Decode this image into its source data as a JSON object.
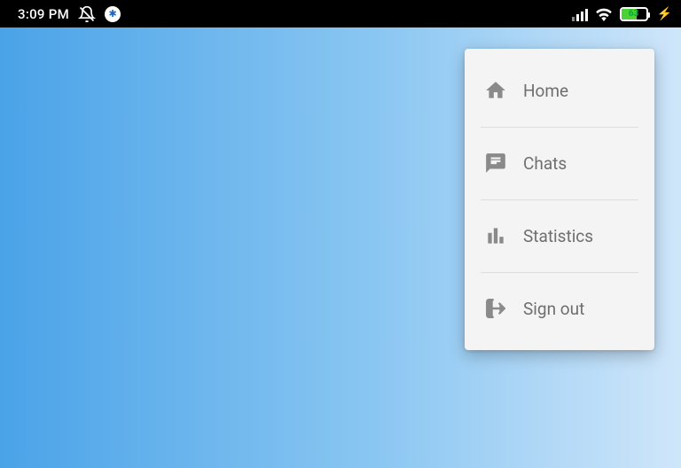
{
  "status": {
    "time": "3:09 PM",
    "battery_percent": "63"
  },
  "menu": {
    "items": [
      {
        "label": "Home"
      },
      {
        "label": "Chats"
      },
      {
        "label": "Statistics"
      },
      {
        "label": "Sign out"
      }
    ]
  }
}
